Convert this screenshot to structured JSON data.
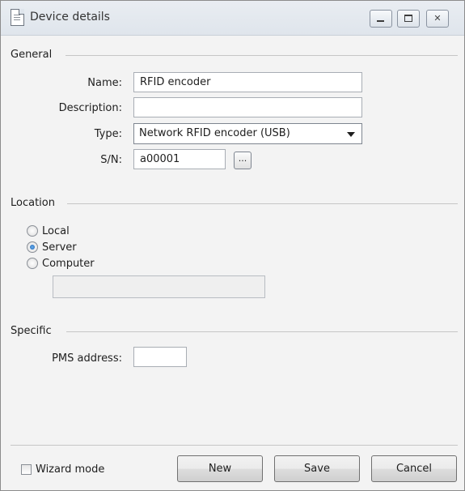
{
  "window": {
    "title": "Device details",
    "controls": {
      "minimize": "",
      "maximize": "",
      "close": "✕"
    }
  },
  "general": {
    "heading": "General",
    "name_label": "Name:",
    "name_value": "RFID encoder",
    "description_label": "Description:",
    "description_value": "",
    "type_label": "Type:",
    "type_value": "Network RFID encoder (USB)",
    "sn_label": "S/N:",
    "sn_value": "a00001",
    "browse_label": "..."
  },
  "location": {
    "heading": "Location",
    "options": [
      "Local",
      "Server",
      "Computer"
    ],
    "selected": "Server",
    "computer_value": ""
  },
  "specific": {
    "heading": "Specific",
    "pms_label": "PMS address:",
    "pms_value": ""
  },
  "footer": {
    "wizard_label": "Wizard mode",
    "wizard_checked": false,
    "new_label": "New",
    "save_label": "Save",
    "cancel_label": "Cancel"
  }
}
